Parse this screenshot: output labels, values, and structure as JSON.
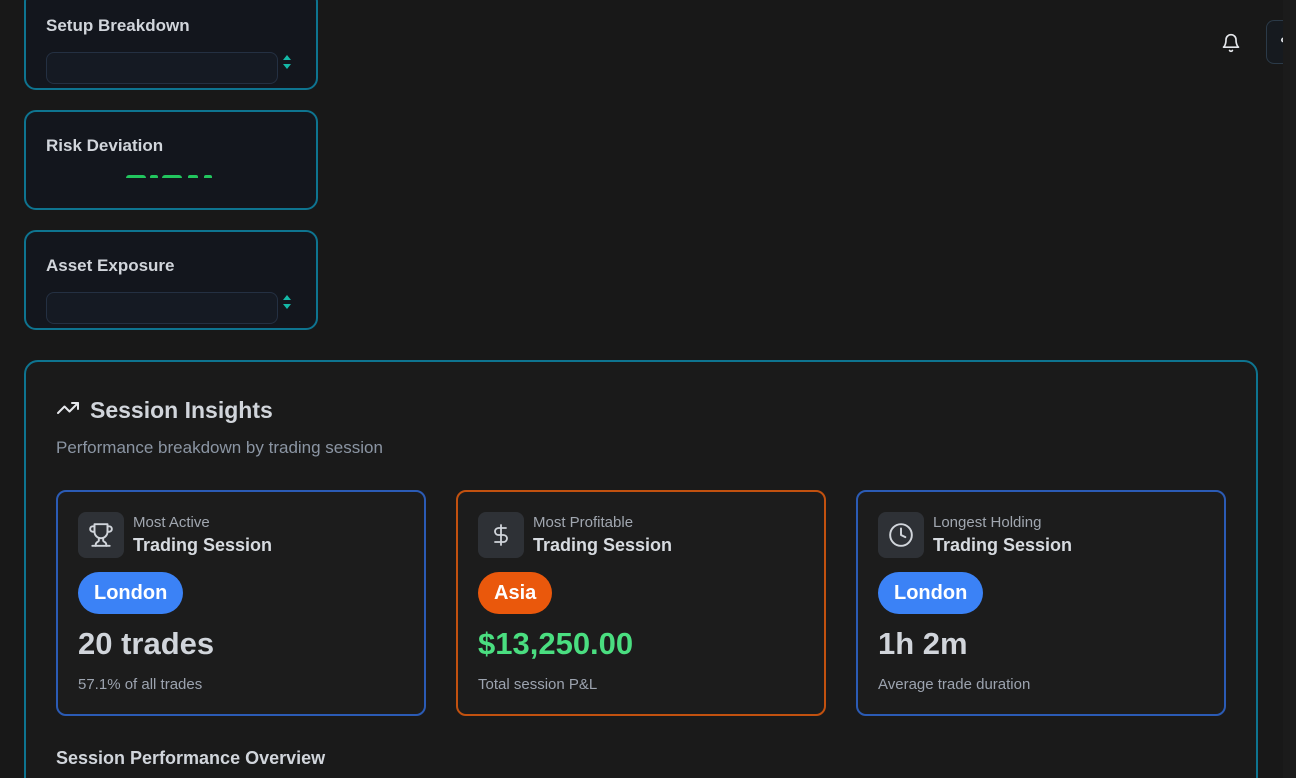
{
  "header": {
    "notifications_icon": "bell-icon",
    "settings_icon": "gear-icon"
  },
  "cards": {
    "setup_breakdown": {
      "title": "Setup Breakdown"
    },
    "risk_deviation": {
      "title": "Risk Deviation",
      "value_color": "#22c55e"
    },
    "asset_exposure": {
      "title": "Asset Exposure"
    }
  },
  "session_insights": {
    "title": "Session Insights",
    "subtitle": "Performance breakdown by trading session",
    "icon": "trending-up-icon",
    "stats": [
      {
        "kicker": "Most Active",
        "heading": "Trading Session",
        "icon": "trophy-icon",
        "session": "London",
        "value": "20 trades",
        "caption": "57.1% of all trades",
        "accent": "#3b82f6"
      },
      {
        "kicker": "Most Profitable",
        "heading": "Trading Session",
        "icon": "dollar-icon",
        "session": "Asia",
        "value": "$13,250.00",
        "caption": "Total session P&L",
        "accent": "#ea580c"
      },
      {
        "kicker": "Longest Holding",
        "heading": "Trading Session",
        "icon": "clock-icon",
        "session": "London",
        "value": "1h 2m",
        "caption": "Average trade duration",
        "accent": "#3b82f6"
      }
    ],
    "overview_title": "Session Performance Overview"
  }
}
